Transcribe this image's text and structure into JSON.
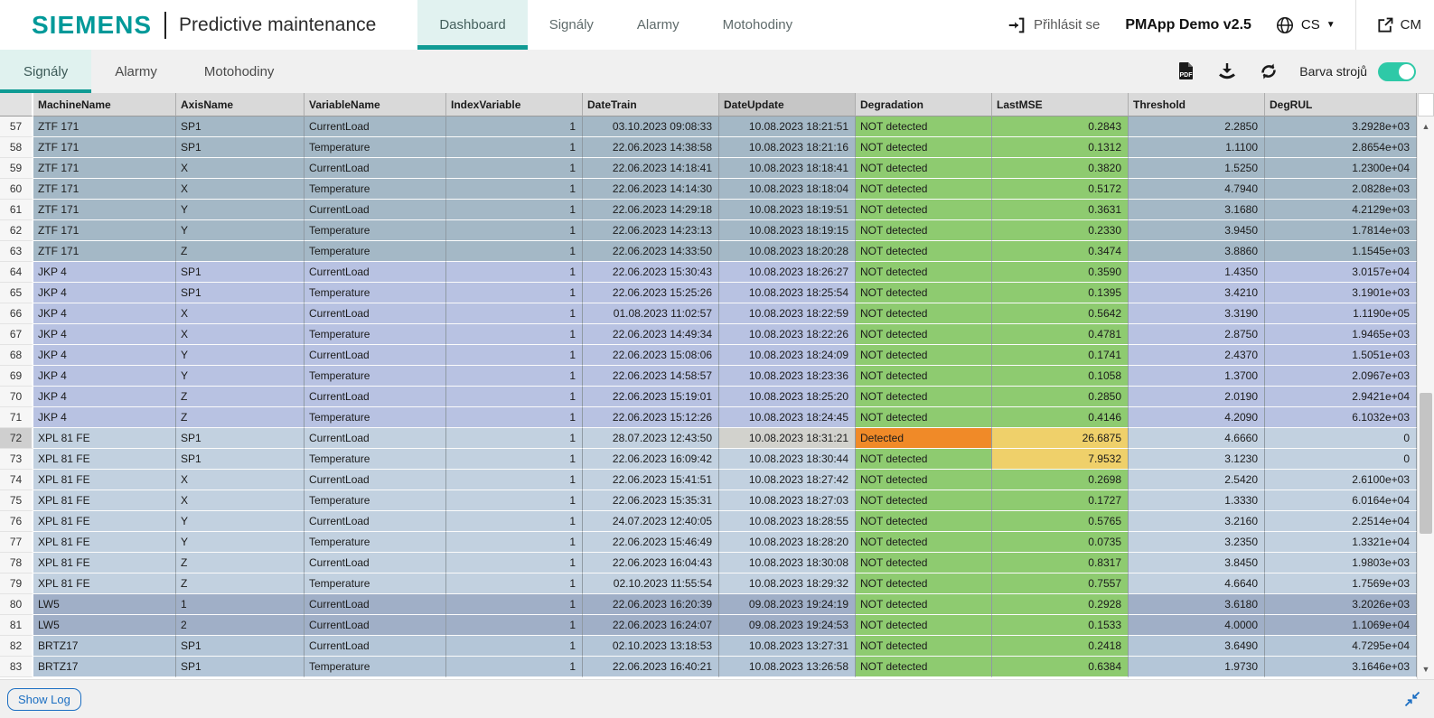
{
  "header": {
    "brand": "SIEMENS",
    "app_title": "Predictive maintenance",
    "nav": [
      {
        "label": "Dashboard",
        "active": true
      },
      {
        "label": "Signály",
        "active": false
      },
      {
        "label": "Alarmy",
        "active": false
      },
      {
        "label": "Motohodiny",
        "active": false
      }
    ],
    "login_label": "Přihlásit se",
    "version_label": "PMApp Demo v2.5",
    "language": "CS",
    "cm_label": "CM"
  },
  "toolbar": {
    "tabs": [
      {
        "label": "Signály",
        "active": true
      },
      {
        "label": "Alarmy",
        "active": false
      },
      {
        "label": "Motohodiny",
        "active": false
      }
    ],
    "icons": [
      "pdf-export-icon",
      "download-icon",
      "refresh-icon"
    ],
    "machine_color_label": "Barva strojů",
    "machine_color_toggle_on": true
  },
  "table": {
    "columns": [
      "MachineName",
      "AxisName",
      "VariableName",
      "IndexVariable",
      "DateTrain",
      "DateUpdate",
      "Degradation",
      "LastMSE",
      "Threshold",
      "DegRUL"
    ],
    "sorted_column": "DateUpdate",
    "row_fields": [
      "num",
      "machine",
      "axis",
      "variable",
      "index",
      "date_train",
      "date_update",
      "degradation",
      "last_mse",
      "threshold",
      "deg_rul",
      "degradation_state",
      "mse_state",
      "selected"
    ],
    "rows": [
      [
        57,
        "ZTF 171",
        "SP1",
        "CurrentLoad",
        "1",
        "03.10.2023 09:08:33",
        "10.08.2023 18:21:51",
        "NOT detected",
        "0.2843",
        "2.2850",
        "3.2928e+03",
        "ok",
        "ok",
        0
      ],
      [
        58,
        "ZTF 171",
        "SP1",
        "Temperature",
        "1",
        "22.06.2023 14:38:58",
        "10.08.2023 18:21:16",
        "NOT detected",
        "0.1312",
        "1.1100",
        "2.8654e+03",
        "ok",
        "ok",
        0
      ],
      [
        59,
        "ZTF 171",
        "X",
        "CurrentLoad",
        "1",
        "22.06.2023 14:18:41",
        "10.08.2023 18:18:41",
        "NOT detected",
        "0.3820",
        "1.5250",
        "1.2300e+04",
        "ok",
        "ok",
        0
      ],
      [
        60,
        "ZTF 171",
        "X",
        "Temperature",
        "1",
        "22.06.2023 14:14:30",
        "10.08.2023 18:18:04",
        "NOT detected",
        "0.5172",
        "4.7940",
        "2.0828e+03",
        "ok",
        "ok",
        0
      ],
      [
        61,
        "ZTF 171",
        "Y",
        "CurrentLoad",
        "1",
        "22.06.2023 14:29:18",
        "10.08.2023 18:19:51",
        "NOT detected",
        "0.3631",
        "3.1680",
        "4.2129e+03",
        "ok",
        "ok",
        0
      ],
      [
        62,
        "ZTF 171",
        "Y",
        "Temperature",
        "1",
        "22.06.2023 14:23:13",
        "10.08.2023 18:19:15",
        "NOT detected",
        "0.2330",
        "3.9450",
        "1.7814e+03",
        "ok",
        "ok",
        0
      ],
      [
        63,
        "ZTF 171",
        "Z",
        "Temperature",
        "1",
        "22.06.2023 14:33:50",
        "10.08.2023 18:20:28",
        "NOT detected",
        "0.3474",
        "3.8860",
        "1.1545e+03",
        "ok",
        "ok",
        0
      ],
      [
        64,
        "JKP 4",
        "SP1",
        "CurrentLoad",
        "1",
        "22.06.2023 15:30:43",
        "10.08.2023 18:26:27",
        "NOT detected",
        "0.3590",
        "1.4350",
        "3.0157e+04",
        "ok",
        "ok",
        0
      ],
      [
        65,
        "JKP 4",
        "SP1",
        "Temperature",
        "1",
        "22.06.2023 15:25:26",
        "10.08.2023 18:25:54",
        "NOT detected",
        "0.1395",
        "3.4210",
        "3.1901e+03",
        "ok",
        "ok",
        0
      ],
      [
        66,
        "JKP 4",
        "X",
        "CurrentLoad",
        "1",
        "01.08.2023 11:02:57",
        "10.08.2023 18:22:59",
        "NOT detected",
        "0.5642",
        "3.3190",
        "1.1190e+05",
        "ok",
        "ok",
        0
      ],
      [
        67,
        "JKP 4",
        "X",
        "Temperature",
        "1",
        "22.06.2023 14:49:34",
        "10.08.2023 18:22:26",
        "NOT detected",
        "0.4781",
        "2.8750",
        "1.9465e+03",
        "ok",
        "ok",
        0
      ],
      [
        68,
        "JKP 4",
        "Y",
        "CurrentLoad",
        "1",
        "22.06.2023 15:08:06",
        "10.08.2023 18:24:09",
        "NOT detected",
        "0.1741",
        "2.4370",
        "1.5051e+03",
        "ok",
        "ok",
        0
      ],
      [
        69,
        "JKP 4",
        "Y",
        "Temperature",
        "1",
        "22.06.2023 14:58:57",
        "10.08.2023 18:23:36",
        "NOT detected",
        "0.1058",
        "1.3700",
        "2.0967e+03",
        "ok",
        "ok",
        0
      ],
      [
        70,
        "JKP 4",
        "Z",
        "CurrentLoad",
        "1",
        "22.06.2023 15:19:01",
        "10.08.2023 18:25:20",
        "NOT detected",
        "0.2850",
        "2.0190",
        "2.9421e+04",
        "ok",
        "ok",
        0
      ],
      [
        71,
        "JKP 4",
        "Z",
        "Temperature",
        "1",
        "22.06.2023 15:12:26",
        "10.08.2023 18:24:45",
        "NOT detected",
        "0.4146",
        "4.2090",
        "6.1032e+03",
        "ok",
        "ok",
        0
      ],
      [
        72,
        "XPL 81 FE",
        "SP1",
        "CurrentLoad",
        "1",
        "28.07.2023 12:43:50",
        "10.08.2023 18:31:21",
        "Detected",
        "26.6875",
        "4.6660",
        "0",
        "detected",
        "warn",
        1
      ],
      [
        73,
        "XPL 81 FE",
        "SP1",
        "Temperature",
        "1",
        "22.06.2023 16:09:42",
        "10.08.2023 18:30:44",
        "NOT detected",
        "7.9532",
        "3.1230",
        "0",
        "ok",
        "warn",
        0
      ],
      [
        74,
        "XPL 81 FE",
        "X",
        "CurrentLoad",
        "1",
        "22.06.2023 15:41:51",
        "10.08.2023 18:27:42",
        "NOT detected",
        "0.2698",
        "2.5420",
        "2.6100e+03",
        "ok",
        "ok",
        0
      ],
      [
        75,
        "XPL 81 FE",
        "X",
        "Temperature",
        "1",
        "22.06.2023 15:35:31",
        "10.08.2023 18:27:03",
        "NOT detected",
        "0.1727",
        "1.3330",
        "6.0164e+04",
        "ok",
        "ok",
        0
      ],
      [
        76,
        "XPL 81 FE",
        "Y",
        "CurrentLoad",
        "1",
        "24.07.2023 12:40:05",
        "10.08.2023 18:28:55",
        "NOT detected",
        "0.5765",
        "3.2160",
        "2.2514e+04",
        "ok",
        "ok",
        0
      ],
      [
        77,
        "XPL 81 FE",
        "Y",
        "Temperature",
        "1",
        "22.06.2023 15:46:49",
        "10.08.2023 18:28:20",
        "NOT detected",
        "0.0735",
        "3.2350",
        "1.3321e+04",
        "ok",
        "ok",
        0
      ],
      [
        78,
        "XPL 81 FE",
        "Z",
        "CurrentLoad",
        "1",
        "22.06.2023 16:04:43",
        "10.08.2023 18:30:08",
        "NOT detected",
        "0.8317",
        "3.8450",
        "1.9803e+03",
        "ok",
        "ok",
        0
      ],
      [
        79,
        "XPL 81 FE",
        "Z",
        "Temperature",
        "1",
        "02.10.2023 11:55:54",
        "10.08.2023 18:29:32",
        "NOT detected",
        "0.7557",
        "4.6640",
        "1.7569e+03",
        "ok",
        "ok",
        0
      ],
      [
        80,
        "LW5",
        "1",
        "CurrentLoad",
        "1",
        "22.06.2023 16:20:39",
        "09.08.2023 19:24:19",
        "NOT detected",
        "0.2928",
        "3.6180",
        "3.2026e+03",
        "ok",
        "ok",
        0
      ],
      [
        81,
        "LW5",
        "2",
        "CurrentLoad",
        "1",
        "22.06.2023 16:24:07",
        "09.08.2023 19:24:53",
        "NOT detected",
        "0.1533",
        "4.0000",
        "1.1069e+04",
        "ok",
        "ok",
        0
      ],
      [
        82,
        "BRTZ17",
        "SP1",
        "CurrentLoad",
        "1",
        "02.10.2023 13:18:53",
        "10.08.2023 13:27:31",
        "NOT detected",
        "0.2418",
        "3.6490",
        "4.7295e+04",
        "ok",
        "ok",
        0
      ],
      [
        83,
        "BRTZ17",
        "SP1",
        "Temperature",
        "1",
        "22.06.2023 16:40:21",
        "10.08.2023 13:26:58",
        "NOT detected",
        "0.6384",
        "1.9730",
        "3.1646e+03",
        "ok",
        "ok",
        0
      ]
    ]
  },
  "footer": {
    "show_log_label": "Show Log"
  },
  "colors": {
    "brand_teal": "#009999",
    "accent_teal": "#0f9b94",
    "toggle_on": "#2ec9a7",
    "status_ok_green": "#8ecb70",
    "status_detected_orange": "#f08a28",
    "status_warn_amber": "#efd06a",
    "link_blue": "#1b6ec2",
    "machines": {
      "ZTF 171": "#a4b8c6",
      "JKP 4": "#b8c2e2",
      "XPL 81 FE": "#c2d1e0",
      "LW5": "#a0afc7",
      "BRTZ17": "#b4c6d8"
    }
  },
  "icons": {
    "login-icon": "arrow-into-bracket",
    "globe-icon": "globe",
    "caret-down-icon": "▼",
    "external-link-icon": "open-in-new",
    "pdf-export-icon": "file-pdf",
    "download-icon": "download-tray",
    "refresh-icon": "circular-arrows",
    "collapse-icon": "arrows-inward",
    "scroll-up-icon": "▲",
    "scroll-down-icon": "▼"
  }
}
